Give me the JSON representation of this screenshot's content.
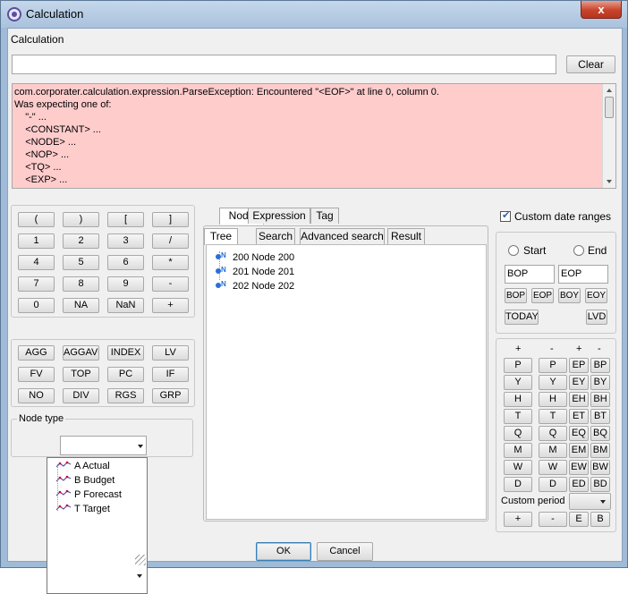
{
  "window": {
    "title": "Calculation",
    "close_glyph": "x"
  },
  "calc_label": "Calculation",
  "expression_value": "",
  "clear_label": "Clear",
  "error_lines": [
    "com.corporater.calculation.expression.ParseException: Encountered \"<EOF>\" at line 0, column 0.",
    "Was expecting one of:",
    "    \"-\" ...",
    "    <CONSTANT> ...",
    "    <NODE> ...",
    "    <NOP> ...",
    "    <TQ> ...",
    "    <EXP> ..."
  ],
  "keypad_rows": [
    [
      "(",
      ")",
      "[",
      "]"
    ],
    [
      "1",
      "2",
      "3",
      "/"
    ],
    [
      "4",
      "5",
      "6",
      "*"
    ],
    [
      "7",
      "8",
      "9",
      "-"
    ],
    [
      "0",
      "NA",
      "NaN",
      "+"
    ]
  ],
  "function_rows": [
    [
      "AGG",
      "AGGAVG",
      "INDEX",
      "LV"
    ],
    [
      "FV",
      "TOP",
      "PC",
      "IF"
    ],
    [
      "NO",
      "DIV",
      "RGS",
      "GRP"
    ]
  ],
  "node_type": {
    "label": "Node type",
    "selected": "",
    "options": [
      "A Actual",
      "B Budget",
      "P Forecast",
      "T Target"
    ]
  },
  "top_tabs": [
    "Node",
    "Expression",
    "Tag"
  ],
  "sub_tabs": [
    "Tree",
    "Search",
    "Advanced search",
    "Result"
  ],
  "tree_nodes": [
    "200 Node 200",
    "201 Node 201",
    "202 Node 202"
  ],
  "custom_date": {
    "label": "Custom date ranges",
    "checked": true,
    "start_label": "Start",
    "end_label": "End",
    "start_value": "BOP",
    "end_value": "EOP",
    "quick_buttons": [
      "BOP",
      "EOP",
      "BOY",
      "EOY"
    ],
    "today_label": "TODAY",
    "lvd_label": "LVD"
  },
  "period": {
    "headers": [
      "+",
      "-",
      "+",
      "-"
    ],
    "rows": [
      [
        "P",
        "P",
        "EP",
        "BP"
      ],
      [
        "Y",
        "Y",
        "EY",
        "BY"
      ],
      [
        "H",
        "H",
        "EH",
        "BH"
      ],
      [
        "T",
        "T",
        "ET",
        "BT"
      ],
      [
        "Q",
        "Q",
        "EQ",
        "BQ"
      ],
      [
        "M",
        "M",
        "EM",
        "BM"
      ],
      [
        "W",
        "W",
        "EW",
        "BW"
      ],
      [
        "D",
        "D",
        "ED",
        "BD"
      ]
    ],
    "custom_label": "Custom period",
    "custom_value": "",
    "bottom_buttons": [
      "+",
      "-",
      "E",
      "B"
    ]
  },
  "ok_label": "OK",
  "cancel_label": "Cancel"
}
